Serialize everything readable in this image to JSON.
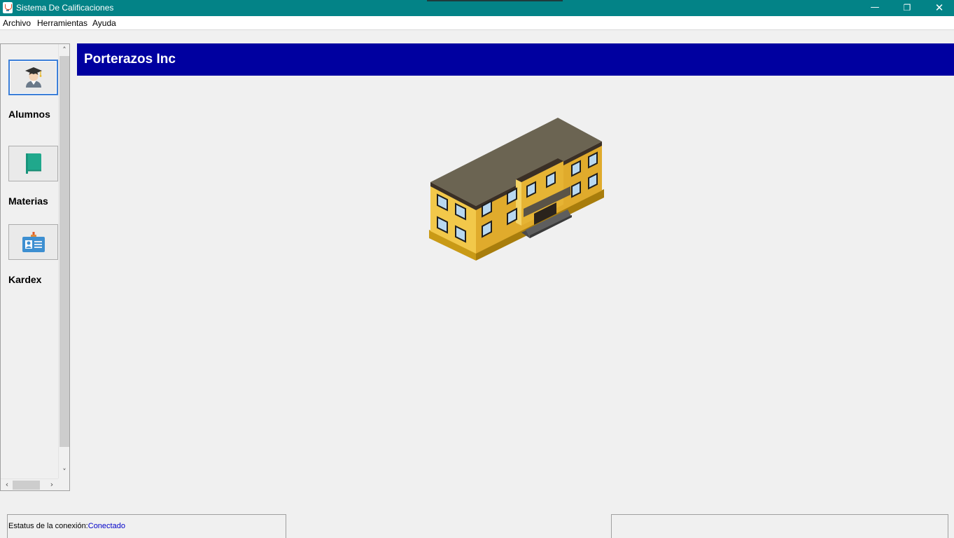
{
  "window": {
    "title": "Sistema De Calificaciones",
    "minimize_glyph": "—",
    "maximize_glyph": "❐",
    "close_glyph": "✕"
  },
  "menu": {
    "items": [
      "Archivo",
      "Herramientas",
      "Ayuda"
    ]
  },
  "sidebar": {
    "items": [
      {
        "label": "Alumnos",
        "icon": "student-icon"
      },
      {
        "label": "Materias",
        "icon": "book-icon"
      },
      {
        "label": "Kardex",
        "icon": "id-card-icon"
      }
    ],
    "scroll_up": "˄",
    "scroll_down": "˅",
    "scroll_left": "‹",
    "scroll_right": "›"
  },
  "header": {
    "company": "Porterazos Inc",
    "color": "#0000a0"
  },
  "main": {
    "image": "school-building-icon"
  },
  "status": {
    "connection_label": "Estatus de la conexión:",
    "connection_value": "Conectado",
    "connection_color": "#0000c8"
  },
  "colors": {
    "titlebar": "#038387",
    "active_border": "#3c7fd8"
  }
}
